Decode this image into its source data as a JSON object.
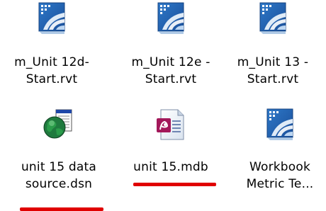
{
  "files": [
    {
      "line1": "m_Unit 12d-",
      "line2": "Start.rvt",
      "icon": "revit-project-icon"
    },
    {
      "line1": "m_Unit 12e -",
      "line2": "Start.rvt",
      "icon": "revit-project-icon"
    },
    {
      "line1": "m_Unit 13 -",
      "line2": "Start.rvt",
      "icon": "revit-project-icon"
    },
    {
      "line1": "unit 15 data",
      "line2": "source.dsn",
      "icon": "odbc-data-source-icon"
    },
    {
      "line1": "unit 15.mdb",
      "line2": "",
      "icon": "access-database-icon"
    },
    {
      "line1": "Workbook",
      "line2": "Metric Te...",
      "icon": "revit-project-icon"
    }
  ],
  "annotation_color": "#e00000"
}
